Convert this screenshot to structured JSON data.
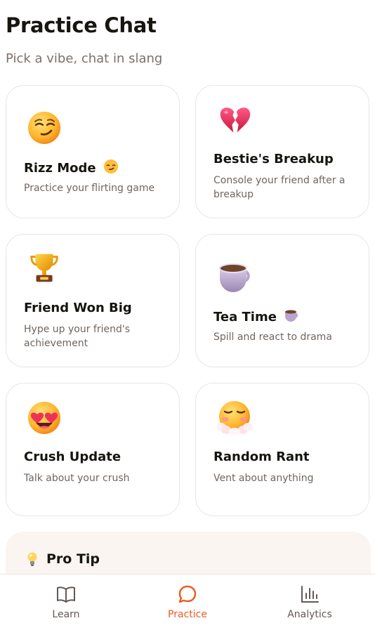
{
  "header": {
    "title": "Practice Chat",
    "subtitle": "Pick a vibe, chat in slang"
  },
  "cards": [
    {
      "title": "Rizz Mode",
      "title_emoji": "smirk-emoji",
      "emoji": "smirking-face-icon",
      "description": "Practice your flirting game"
    },
    {
      "title": "Bestie's Breakup",
      "emoji": "broken-heart-icon",
      "description": "Console your friend after a breakup"
    },
    {
      "title": "Friend Won Big",
      "emoji": "trophy-icon",
      "description": "Hype up your friend's achievement"
    },
    {
      "title": "Tea Time",
      "title_emoji": "tea-cup-emoji",
      "emoji": "tea-cup-icon",
      "description": "Spill and react to drama"
    },
    {
      "title": "Crush Update",
      "emoji": "heart-eyes-face-icon",
      "description": "Talk about your crush"
    },
    {
      "title": "Random Rant",
      "emoji": "exasperated-face-icon",
      "description": "Vent about anything"
    }
  ],
  "tip": {
    "title": "Pro Tip",
    "icon": "light-bulb-icon"
  },
  "nav": {
    "items": [
      {
        "label": "Learn",
        "icon": "book-icon",
        "active": false
      },
      {
        "label": "Practice",
        "icon": "chat-bubble-icon",
        "active": true
      },
      {
        "label": "Analytics",
        "icon": "bar-chart-icon",
        "active": false
      }
    ],
    "accent_color": "#ea5a1f",
    "inactive_color": "#625955"
  }
}
